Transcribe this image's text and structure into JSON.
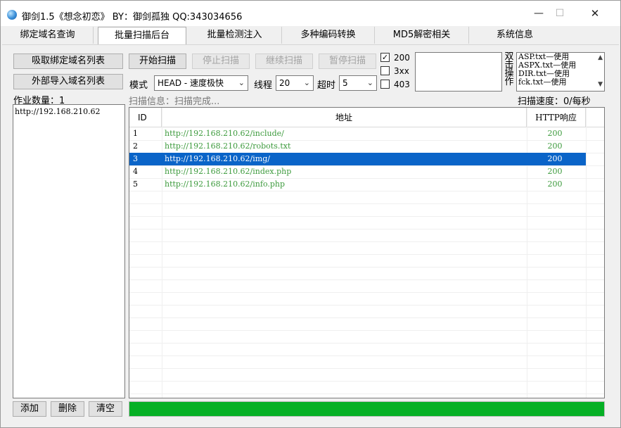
{
  "window": {
    "title": "御剑1.5《想念初恋》 BY：御剑孤独 QQ:343034656",
    "minimize": "—",
    "maximize": "☐",
    "close": "✕"
  },
  "tabs": [
    {
      "label": "绑定域名查询"
    },
    {
      "label": "批量扫描后台"
    },
    {
      "label": "批量检测注入"
    },
    {
      "label": "多种编码转换"
    },
    {
      "label": "MD5解密相关"
    },
    {
      "label": "系统信息"
    }
  ],
  "left": {
    "fetch_button": "吸取绑定域名列表",
    "import_button": "外部导入域名列表",
    "job_count_label": "作业数量：1",
    "domains": [
      "http://192.168.210.62"
    ],
    "add_button": "添加",
    "delete_button": "删除",
    "clear_button": "清空"
  },
  "controls": {
    "start": "开始扫描",
    "stop": "停止扫描",
    "resume": "继续扫描",
    "pause": "暂停扫描",
    "mode_label": "模式",
    "mode_value": "HEAD - 速度极快",
    "threads_label": "线程",
    "threads_value": "20",
    "timeout_label": "超时",
    "timeout_value": "5",
    "scan_info": "扫描信息：扫描完成...",
    "scan_speed": "扫描速度：0/每秒"
  },
  "filters": [
    {
      "label": "200",
      "checked": true,
      "mark": "✓"
    },
    {
      "label": "3xx",
      "checked": false,
      "mark": ""
    },
    {
      "label": "403",
      "checked": false,
      "mark": ""
    }
  ],
  "dict_panel": {
    "vertical_label": [
      "双",
      "击",
      "操",
      "作"
    ],
    "items": [
      "ASP.txt—使用",
      "ASPX.txt—使用",
      "DIR.txt—使用",
      "fck.txt—使用"
    ],
    "scroll_up": "▲",
    "scroll_down": "▼"
  },
  "results": {
    "columns": {
      "id": "ID",
      "url": "地址",
      "code": "HTTP响应"
    },
    "rows": [
      {
        "id": "1",
        "url": "http://192.168.210.62/include/",
        "code": "200",
        "selected": false
      },
      {
        "id": "2",
        "url": "http://192.168.210.62/robots.txt",
        "code": "200",
        "selected": false
      },
      {
        "id": "3",
        "url": "http://192.168.210.62/img/",
        "code": "200",
        "selected": true
      },
      {
        "id": "4",
        "url": "http://192.168.210.62/index.php",
        "code": "200",
        "selected": false
      },
      {
        "id": "5",
        "url": "http://192.168.210.62/info.php",
        "code": "200",
        "selected": false
      }
    ]
  },
  "progress": {
    "fraction": 1.0
  },
  "colors": {
    "selection": "#0a64c8",
    "ok_text": "#3c9a3c",
    "progress": "#06b025"
  }
}
